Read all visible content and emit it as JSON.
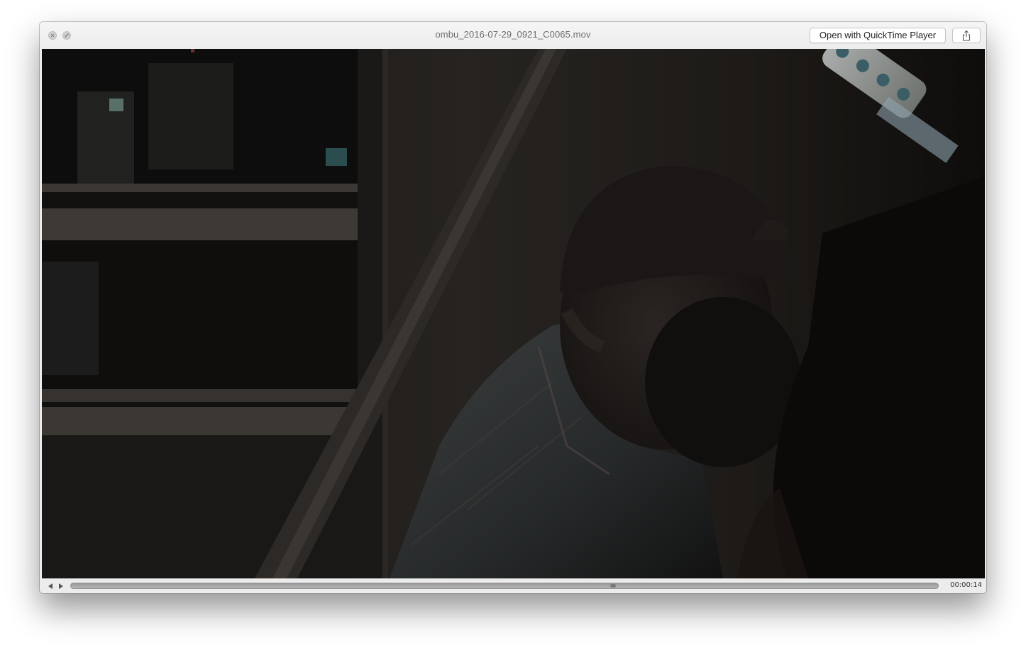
{
  "window": {
    "title": "ombu_2016-07-29_0921_C0065.mov",
    "controls": {
      "close_icon": "close-icon",
      "fullscreen_icon": "fullscreen-icon"
    }
  },
  "toolbar": {
    "open_label": "Open with QuickTime Player",
    "share_icon": "share-icon"
  },
  "player": {
    "content": "video-frame",
    "back_icon": "step-back-icon",
    "play_icon": "play-icon",
    "progress": 0.625,
    "time": "00:00:14"
  },
  "colors": {
    "chrome": "#ececec",
    "video_dark": "#171513",
    "button_border": "#c4c4c4"
  }
}
